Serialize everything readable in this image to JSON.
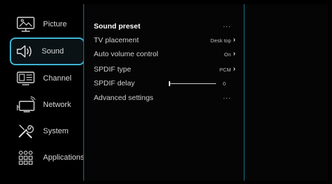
{
  "menu": {
    "items": [
      {
        "label": "Picture",
        "icon": "picture-icon"
      },
      {
        "label": "Sound",
        "icon": "sound-icon",
        "selected": true
      },
      {
        "label": "Channel",
        "icon": "channel-icon"
      },
      {
        "label": "Network",
        "icon": "network-icon"
      },
      {
        "label": "System",
        "icon": "system-icon"
      },
      {
        "label": "Applications",
        "icon": "applications-icon"
      }
    ]
  },
  "sound": {
    "rows": [
      {
        "label": "Sound preset",
        "value": "···"
      },
      {
        "label": "TV placement",
        "value": "Desk top"
      },
      {
        "label": "Auto volume control",
        "value": "On"
      },
      {
        "label": "SPDIF type",
        "value": "PCM"
      },
      {
        "label": "SPDIF delay",
        "value": "0",
        "slider_level": 0
      },
      {
        "label": "Advanced settings",
        "value": "···"
      }
    ]
  },
  "colors": {
    "accent": "#3fb6d6",
    "divider": "#1e6f86",
    "background": "#000000"
  }
}
